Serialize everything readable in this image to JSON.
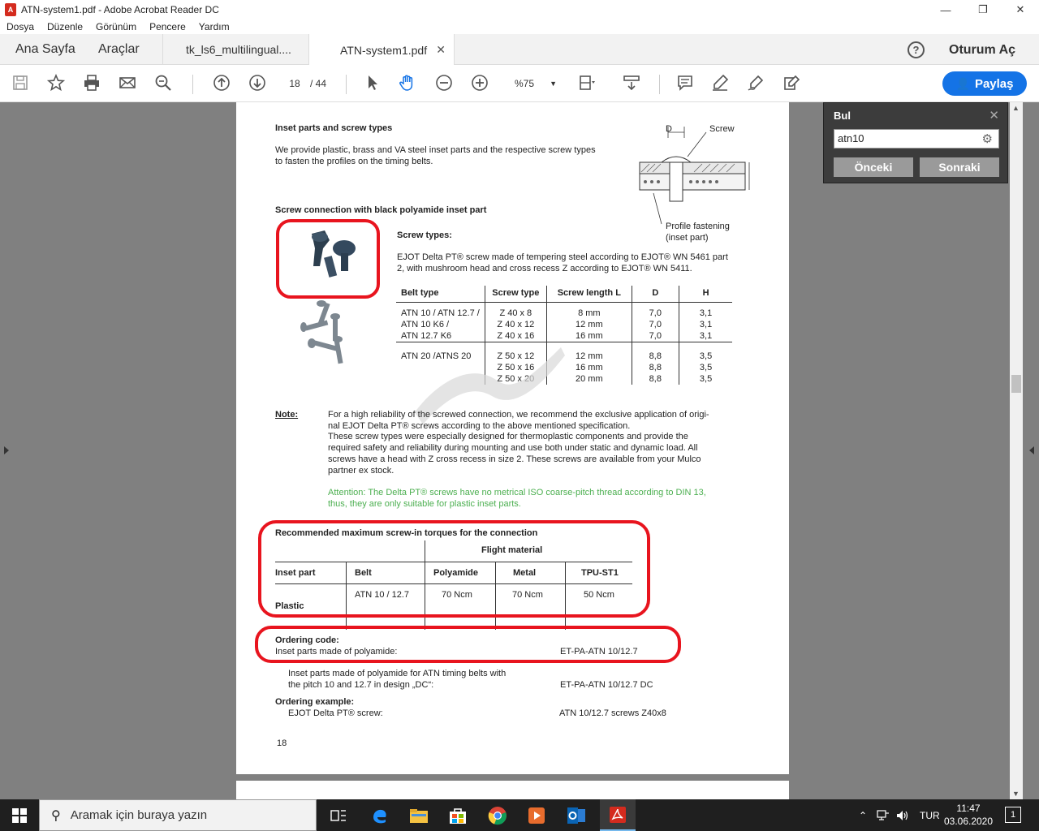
{
  "window": {
    "title": "ATN-system1.pdf - Adobe Acrobat Reader DC"
  },
  "menu": [
    "Dosya",
    "Düzenle",
    "Görünüm",
    "Pencere",
    "Yardım"
  ],
  "tabs": {
    "home": "Ana Sayfa",
    "tools": "Araçlar",
    "doc1": "tk_ls6_multilingual....",
    "doc2": "ATN-system1.pdf",
    "signin": "Oturum Aç"
  },
  "toolbar": {
    "page_current": "18",
    "page_total": "/ 44",
    "zoom": "%75",
    "share": "Paylaş"
  },
  "find": {
    "title": "Bul",
    "query": "atn10",
    "prev": "Önceki",
    "next": "Sonraki"
  },
  "pdf": {
    "heading1": "Inset parts and screw types",
    "intro1": "We provide plastic, brass and VA steel inset parts and the respective screw types",
    "intro2": "to fasten the profiles on the timing belts.",
    "diagram_screw": "Screw",
    "diagram_d": "D",
    "diagram_profile1": "Profile fastening",
    "diagram_profile2": "(inset part)",
    "heading2": "Screw connection with black polyamide inset part",
    "screw_types": "Screw types:",
    "ejot1": "EJOT Delta PT® screw made of tempering steel according to EJOT® WN 5461 part",
    "ejot2": "2, with mushroom head and cross recess Z according to EJOT® WN 5411.",
    "belt_table": {
      "headers": [
        "Belt type",
        "Screw type",
        "Screw length L",
        "D",
        "H"
      ],
      "group1": {
        "belt": [
          "ATN 10 / ATN 12.7 /",
          "ATN 10 K6 /",
          "ATN 12.7  K6"
        ],
        "screw": [
          "Z 40 x 8",
          "Z 40 x 12",
          "Z 40 x 16"
        ],
        "length": [
          "8 mm",
          "12 mm",
          "16 mm"
        ],
        "d": [
          "7,0",
          "7,0",
          "7,0"
        ],
        "h": [
          "3,1",
          "3,1",
          "3,1"
        ]
      },
      "group2": {
        "belt": [
          "ATN 20 /ATNS 20",
          "",
          ""
        ],
        "screw": [
          "Z 50 x 12",
          "Z 50 x 16",
          "Z 50 x 20"
        ],
        "length": [
          "12 mm",
          "16 mm",
          "20 mm"
        ],
        "d": [
          "8,8",
          "8,8",
          "8,8"
        ],
        "h": [
          "3,5",
          "3,5",
          "3,5"
        ]
      }
    },
    "note_label": "Note:",
    "note_lines": [
      "For a high reliability of the screwed connection, we recommend the exclusive application of origi-",
      "nal EJOT Delta PT® screws according to the above mentioned specification.",
      "These screw types were especially designed for thermoplastic components and provide the",
      "required safety and reliability during mounting and use both under static and dynamic load. All",
      "screws have a head with Z cross recess in size 2. These screws are available from your Mulco",
      "partner ex stock."
    ],
    "attention1": "Attention: The Delta PT® screws have no metrical ISO coarse-pitch thread according to DIN 13,",
    "attention2": "thus, they are only suitable for plastic inset parts.",
    "torque_title": "Recommended maximum screw-in torques for the connection",
    "torque_flight": "Flight material",
    "torque_headers": [
      "Inset part",
      "Belt",
      "Polyamide",
      "Metal",
      "TPU-ST1"
    ],
    "torque_row": [
      "Plastic",
      "ATN 10 / 12.7",
      "70 Ncm",
      "70 Ncm",
      "50 Ncm"
    ],
    "ordering_code": "Ordering code:",
    "order1_left": "Inset parts made of polyamide:",
    "order1_right": "ET-PA-ATN 10/12.7",
    "order2_left1": "Inset parts made of polyamide for ATN timing belts with",
    "order2_left2": "the pitch 10 and 12.7 in design „DC“:",
    "order2_right": "ET-PA-ATN 10/12.7 DC",
    "ordering_example": "Ordering example:",
    "example_left": "EJOT Delta PT® screw:",
    "example_hl": "ATN 10/",
    "example_rest": "12.7 screws Z40x8",
    "page_number": "18"
  },
  "taskbar": {
    "search_placeholder": "Aramak için buraya yazın",
    "lang": "TUR",
    "time": "11:47",
    "date": "03.06.2020",
    "notif_count": "1"
  }
}
